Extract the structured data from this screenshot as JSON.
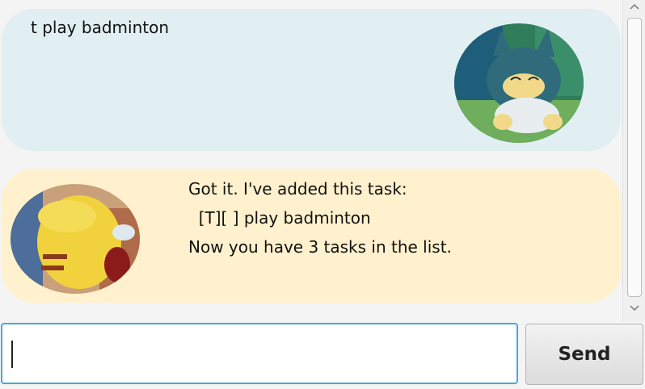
{
  "messages": [
    {
      "sender": "user",
      "text": "t play badminton",
      "avatar_icon": "munchlax-avatar-icon",
      "bubble_color": "#e1eff3"
    },
    {
      "sender": "bot",
      "text": "Got it. I've added this task:\n  [T][ ] play badminton\nNow you have 3 tasks in the list.",
      "avatar_icon": "pikachu-avatar-icon",
      "bubble_color": "#fff1cd"
    }
  ],
  "input": {
    "value": "",
    "placeholder": ""
  },
  "send_button": {
    "label": "Send"
  },
  "colors": {
    "input_focus_border": "#4aa8d8",
    "background": "#f4f4f4"
  }
}
